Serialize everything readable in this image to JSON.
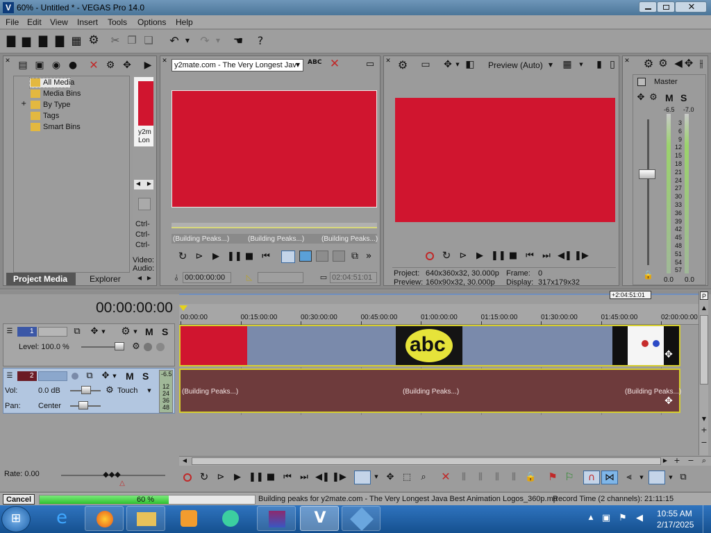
{
  "window": {
    "title": "60% - Untitled * - VEGAS Pro 14.0"
  },
  "menu": {
    "items": [
      "File",
      "Edit",
      "View",
      "Insert",
      "Tools",
      "Options",
      "Help"
    ]
  },
  "media_tree": {
    "items": [
      "All Media",
      "Media Bins",
      "By Type",
      "Tags",
      "Smart Bins"
    ],
    "thumb_caption_1": "y2m",
    "thumb_caption_2": "Lon",
    "ctrl_labels": [
      "Ctrl-",
      "Ctrl-",
      "Ctrl-"
    ],
    "video_label": "Video:",
    "audio_label": "Audio:"
  },
  "tabs": {
    "project_media": "Project Media",
    "explorer": "Explorer"
  },
  "trimmer": {
    "source_select": "y2mate.com - The Very Longest Jav",
    "peaks": [
      "(Building Peaks...)",
      "(Building Peaks...)",
      "(Building Peaks...)"
    ],
    "timecode": "00:00:00:00",
    "length": "02:04:51:01"
  },
  "preview": {
    "mode": "Preview (Auto)",
    "project_label": "Project:",
    "project_value": "640x360x32, 30.000p",
    "preview_label": "Preview:",
    "preview_value": "160x90x32, 30.000p",
    "frame_label": "Frame:",
    "frame_value": "0",
    "display_label": "Display:",
    "display_value": "317x179x32"
  },
  "mixer": {
    "master_label": "Master",
    "m_label": "M",
    "s_label": "S",
    "peak_left": "-6.5",
    "peak_right": "-7.0",
    "scale": [
      "3",
      "6",
      "9",
      "12",
      "15",
      "18",
      "21",
      "24",
      "27",
      "30",
      "33",
      "36",
      "39",
      "42",
      "45",
      "48",
      "51",
      "54",
      "57"
    ],
    "value_left": "0.0",
    "value_right": "0.0"
  },
  "timeline": {
    "timecode": "00:00:00:00",
    "end_marker": "+2:04:51:01",
    "ruler": [
      "00:00:00",
      "00:15:00:00",
      "00:30:00:00",
      "00:45:00:00",
      "01:00:00:00",
      "01:15:00:00",
      "01:30:00:00",
      "01:45:00:00",
      "02:00:00:00"
    ],
    "track1": {
      "number": "1",
      "level_label": "Level: 100.0 %",
      "m_label": "M",
      "s_label": "S"
    },
    "track2": {
      "number": "2",
      "vol_label": "Vol:",
      "vol_value": "0.0 dB",
      "pan_label": "Pan:",
      "pan_value": "Center",
      "touch_label": "Touch",
      "m_label": "M",
      "s_label": "S",
      "meter_peak": "-6.5",
      "meter_scale": [
        "12",
        "24",
        "36",
        "48"
      ]
    },
    "audio_peaks": [
      "(Building Peaks...)",
      "(Building Peaks...)",
      "(Building Peaks...)"
    ],
    "logo_text": "abc",
    "rate_label": "Rate: 0.00"
  },
  "statusbar": {
    "cancel": "Cancel",
    "progress_label": "60 %",
    "progress_fraction": 0.6,
    "message": "Building peaks for y2mate.com - The Very Longest Java Best Animation Logos_360p.mp",
    "record_time": "Record Time (2 channels): 21:11:15"
  },
  "taskbar": {
    "time": "10:55 AM",
    "date": "2/17/2025"
  },
  "colors": {
    "clip_red": "#d0152f",
    "video_track": "#7a8aab",
    "audio_track": "#6e3b3c",
    "progress_green": "#2fc12f",
    "taskbar": "#1b5fa8",
    "window_bg": "#9b9b9b"
  }
}
